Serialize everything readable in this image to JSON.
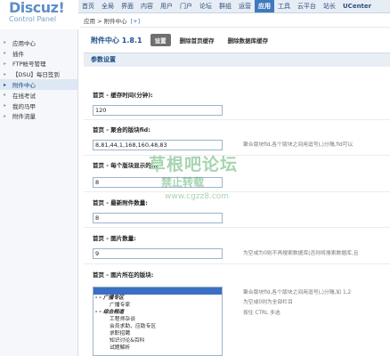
{
  "logo": {
    "brand": "Discuz!",
    "subtitle": "Control Panel"
  },
  "topnav": [
    "首页",
    "全局",
    "界面",
    "内容",
    "用户",
    "门户",
    "论坛",
    "群组",
    "运营",
    "应用",
    "工具",
    "云平台",
    "站长",
    "UCenter"
  ],
  "topnav_active": "应用",
  "sidebar": [
    "应用中心",
    "插件",
    "FTP帐号管理",
    "【DSU】每日签到",
    "附件中心",
    "在线考试",
    "我的马甲",
    "附件流量"
  ],
  "sidebar_active": "附件中心",
  "breadcrumb": {
    "text": "应用 > 附件中心",
    "pin": "[+]"
  },
  "plugin": {
    "title": "附件中心 1.8.1",
    "tabs": [
      "设置",
      "删除首页缓存",
      "删除数据库缓存"
    ]
  },
  "section_title": "参数设置",
  "fields": {
    "cache_time": {
      "label": "首页 - 缓存时间(分钟):",
      "value": "120"
    },
    "forum_ids": {
      "label": "首页 - 聚合的版块fid:",
      "value": "8,81,44,1,168,160,48,83",
      "desc": "聚合版块fid,各个版块之间用逗号(,)分隔,fid可以"
    },
    "per_forum": {
      "label": "首页 - 每个版块显示的...",
      "value": "8"
    },
    "latest": {
      "label": "首页 - 最新附件数量:",
      "value": "8"
    },
    "images": {
      "label": "首页 - 图片数量:",
      "value": "9",
      "desc": "为空或为0则不再搜索数据库(否则将搜索数据库,且"
    },
    "image_forums": {
      "label": "首页 - 图片所在的版块:",
      "desc1": "聚合版块fid,各个版块之间用逗号(,)分隔,如 1,2",
      "desc2": "为空或0则为全部栏目",
      "desc3": "按住 CTRL 多选"
    }
  },
  "area_options": [
    "",
    "- - 广播专区",
    "广播专家",
    "- - 综合频道",
    "工程师杂谈",
    "会员求助、应助专区",
    "求职招聘",
    "知识讨论&百科",
    "试题解析"
  ],
  "watermark": {
    "title": "草根吧论坛",
    "subtitle": "禁止转载",
    "url": "www.cgzz8.com"
  }
}
